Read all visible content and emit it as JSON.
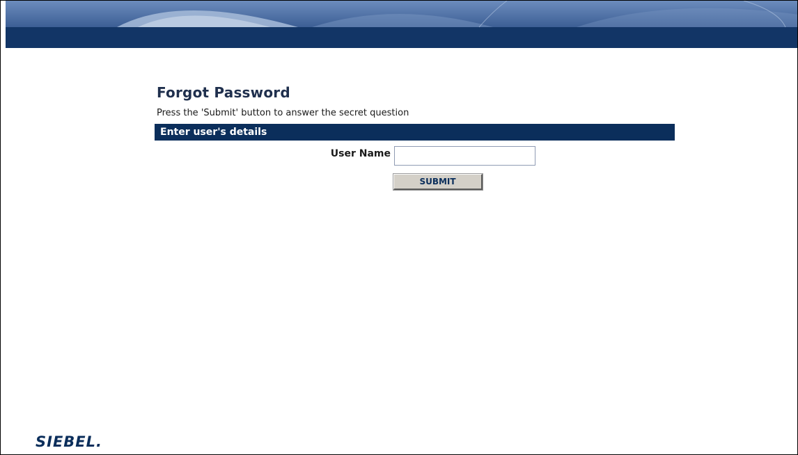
{
  "page": {
    "title": "Forgot Password",
    "instructions": "Press the 'Submit' button to answer the secret question"
  },
  "section": {
    "header": "Enter user's details"
  },
  "form": {
    "username_label": "User Name",
    "username_value": "",
    "submit_label": "SUBMIT"
  },
  "footer": {
    "logo_text": "SIEBEL."
  },
  "colors": {
    "banner_dark": "#0b2e5b",
    "banner_light": "#5d7fb0",
    "section_header_bg": "#0b2e5b",
    "title_text": "#1f2f4d"
  }
}
